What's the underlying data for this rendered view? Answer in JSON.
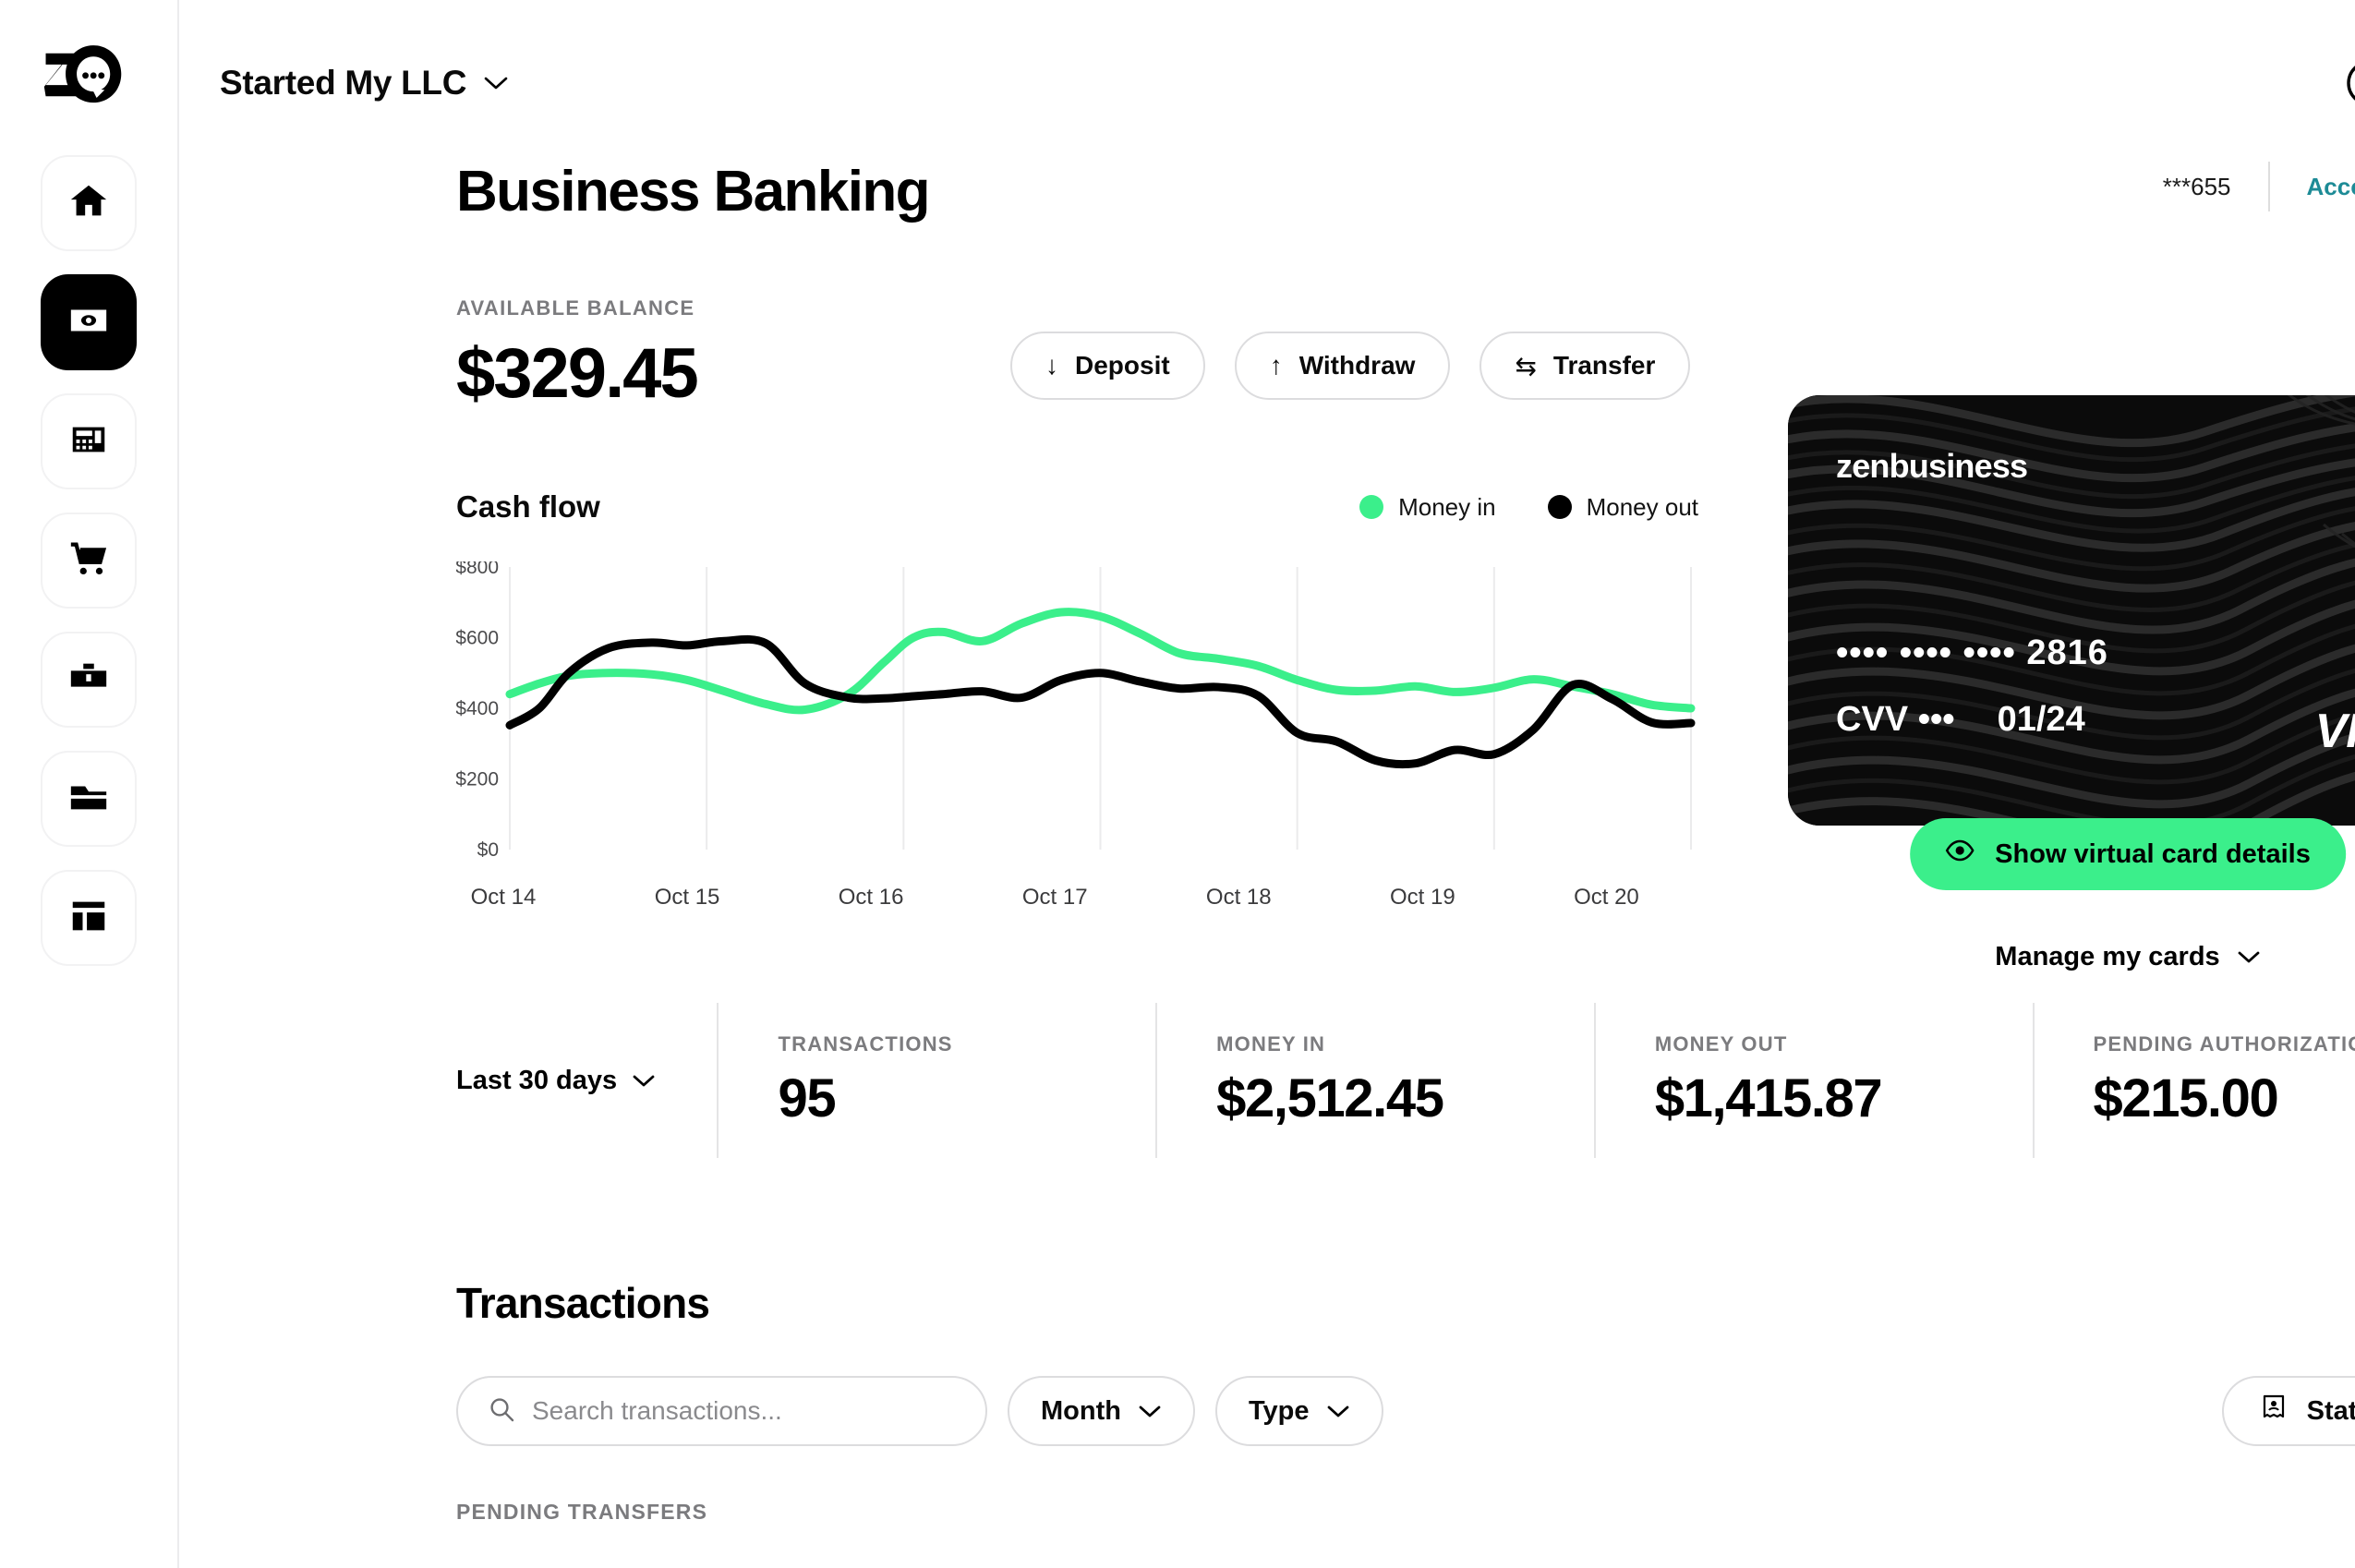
{
  "brand": {
    "logo_icon": "zenbusiness-zb-logo",
    "accent_green": "#3bef8b",
    "accent_teal": "#1d8b96"
  },
  "sidebar": {
    "items": [
      {
        "icon": "home-icon",
        "name": "home",
        "active": false
      },
      {
        "icon": "banking-icon",
        "name": "banking",
        "active": true
      },
      {
        "icon": "calculator-icon",
        "name": "accounting",
        "active": false
      },
      {
        "icon": "shopping-cart-icon",
        "name": "commerce",
        "active": false
      },
      {
        "icon": "toolbox-icon",
        "name": "tools",
        "active": false
      },
      {
        "icon": "folder-icon",
        "name": "documents",
        "active": false
      },
      {
        "icon": "dashboard-layout-icon",
        "name": "website",
        "active": false
      }
    ]
  },
  "topbar": {
    "org_name": "Started My LLC",
    "org_chevron_icon": "chevron-down-icon",
    "check_icon": "check-circle-icon",
    "account_icon": "user-circle-icon"
  },
  "header": {
    "page_title": "Business Banking",
    "account_mask": "***655",
    "account_details_link": "Account Details"
  },
  "balance": {
    "label": "AVAILABLE BALANCE",
    "amount": "$329.45",
    "actions": [
      {
        "glyph": "↓",
        "label": "Deposit",
        "icon": "arrow-down-icon"
      },
      {
        "glyph": "↑",
        "label": "Withdraw",
        "icon": "arrow-up-icon"
      },
      {
        "glyph": "⇆",
        "label": "Transfer",
        "icon": "transfer-arrows-icon"
      }
    ]
  },
  "chart_data": {
    "type": "line",
    "title": "Cash flow",
    "xlabel": "",
    "ylabel": "",
    "ylim": [
      0,
      800
    ],
    "ytick_labels": [
      "$800",
      "$600",
      "$400",
      "$200",
      "$0"
    ],
    "yticks": [
      800,
      600,
      400,
      200,
      0
    ],
    "categories": [
      "Oct 14",
      "Oct 15",
      "Oct 16",
      "Oct 17",
      "Oct 18",
      "Oct 19",
      "Oct 20"
    ],
    "grid": "vertical",
    "legend_position": "top-right",
    "series": [
      {
        "name": "Money in",
        "color": "#3bef8b",
        "x": [
          0,
          0.15,
          0.3,
          0.5,
          0.72,
          0.9,
          1.08,
          1.3,
          1.5,
          1.72,
          1.9,
          2.05,
          2.2,
          2.4,
          2.6,
          2.8,
          3.0,
          3.2,
          3.4,
          3.6,
          3.8,
          4.0,
          4.2,
          4.4,
          4.6,
          4.8,
          5.0,
          5.2,
          5.4,
          5.6,
          5.8,
          6.0
        ],
        "values": [
          440,
          470,
          492,
          500,
          496,
          480,
          450,
          412,
          396,
          440,
          530,
          600,
          616,
          590,
          640,
          672,
          660,
          612,
          556,
          540,
          520,
          480,
          452,
          450,
          462,
          446,
          458,
          482,
          462,
          440,
          410,
          400
        ]
      },
      {
        "name": "Money out",
        "color": "#000000",
        "x": [
          0,
          0.15,
          0.3,
          0.5,
          0.72,
          0.9,
          1.08,
          1.3,
          1.5,
          1.72,
          1.9,
          2.05,
          2.2,
          2.4,
          2.6,
          2.8,
          3.0,
          3.2,
          3.4,
          3.6,
          3.8,
          4.0,
          4.2,
          4.4,
          4.6,
          4.8,
          5.0,
          5.2,
          5.4,
          5.6,
          5.8,
          6.0
        ],
        "values": [
          352,
          400,
          500,
          570,
          586,
          578,
          590,
          584,
          470,
          430,
          428,
          434,
          440,
          448,
          430,
          480,
          500,
          476,
          456,
          460,
          436,
          330,
          306,
          252,
          244,
          282,
          270,
          340,
          466,
          426,
          360,
          358
        ]
      }
    ],
    "legend": [
      {
        "label": "Money in",
        "color": "#3bef8b"
      },
      {
        "label": "Money out",
        "color": "#000000"
      }
    ]
  },
  "card": {
    "brand_name": "zenbusiness",
    "number_masked": "•••• •••• •••• 2816",
    "cvv_label": "CVV",
    "cvv_masked": "•••",
    "expiry": "01/24",
    "network": "VISA",
    "show_details_label": "Show virtual card details",
    "show_details_icon": "eye-icon",
    "manage_label": "Manage my cards",
    "manage_chevron_icon": "chevron-down-icon"
  },
  "stats": {
    "range_label": "Last 30 days",
    "range_chevron_icon": "chevron-down-icon",
    "items": [
      {
        "label": "TRANSACTIONS",
        "value": "95"
      },
      {
        "label": "MONEY IN",
        "value": "$2,512.45"
      },
      {
        "label": "MONEY OUT",
        "value": "$1,415.87"
      },
      {
        "label": "PENDING AUTHORIZATIONS",
        "value": "$215.00"
      }
    ]
  },
  "transactions": {
    "heading": "Transactions",
    "search_placeholder": "Search transactions...",
    "search_value": "",
    "search_icon": "search-icon",
    "filters": [
      {
        "label": "Month",
        "icon": "chevron-down-icon"
      },
      {
        "label": "Type",
        "icon": "chevron-down-icon"
      }
    ],
    "statements_label": "Statements",
    "statements_icon": "receipt-icon",
    "pending_label": "PENDING TRANSFERS"
  }
}
